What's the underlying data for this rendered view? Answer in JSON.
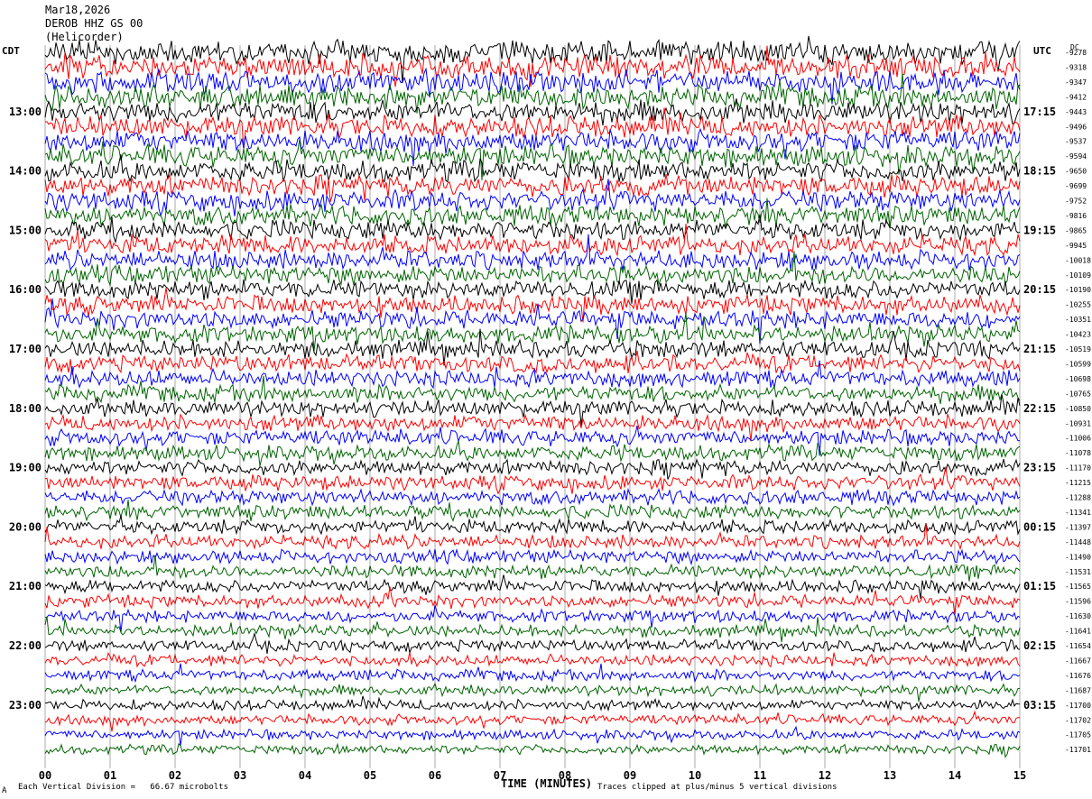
{
  "header": {
    "date": "Mar18,2026",
    "station": "DEROB HHZ GS 00",
    "scale": "(Helicorder)"
  },
  "left_zone_label": "CDT",
  "right_zone_label": "UTC",
  "dc_label": "DC",
  "footer": {
    "scale_note": "Each Vertical Division =   66.67 microbolts",
    "clip_note": "Traces clipped at plus/minus 5 vertical divisions",
    "corner_mark": "A"
  },
  "colors": {
    "trace_cycle": [
      "#000000",
      "#ff0000",
      "#0000ff",
      "#006400"
    ],
    "grid": "#000000"
  },
  "chart_data": {
    "type": "line",
    "title": "",
    "xlabel": "TIME (MINUTES)",
    "ylabel": "",
    "x_ticks": [
      "00",
      "01",
      "02",
      "03",
      "04",
      "05",
      "06",
      "07",
      "08",
      "09",
      "10",
      "11",
      "12",
      "13",
      "14",
      "15"
    ],
    "xlim": [
      0,
      15
    ],
    "left_hour_labels": [
      "13:00",
      "14:00",
      "15:00",
      "16:00",
      "17:00",
      "18:00",
      "19:00",
      "20:00",
      "21:00",
      "22:00",
      "23:00"
    ],
    "right_hour_labels": [
      "17:15",
      "18:15",
      "19:15",
      "20:15",
      "21:15",
      "22:15",
      "23:15",
      "00:15",
      "01:15",
      "02:15",
      "03:15"
    ],
    "dc_offsets": [
      "-9278",
      "-9318",
      "-9347",
      "-9412",
      "-9443",
      "-9496",
      "-9537",
      "-9594",
      "-9650",
      "-9699",
      "-9752",
      "-9816",
      "-9865",
      "-9945",
      "-10018",
      "-10109",
      "-10190",
      "-10255",
      "-10351",
      "-10423",
      "-10519",
      "-10599",
      "-10698",
      "-10765",
      "-10850",
      "-10931",
      "-11006",
      "-11078",
      "-11170",
      "-11215",
      "-11288",
      "-11341",
      "-11397",
      "-11448",
      "-11490",
      "-11531",
      "-11565",
      "-11596",
      "-11630",
      "-11641",
      "-11654",
      "-11667",
      "-11676",
      "-11687",
      "-11700",
      "-11702",
      "-11705",
      "-11701"
    ]
  }
}
